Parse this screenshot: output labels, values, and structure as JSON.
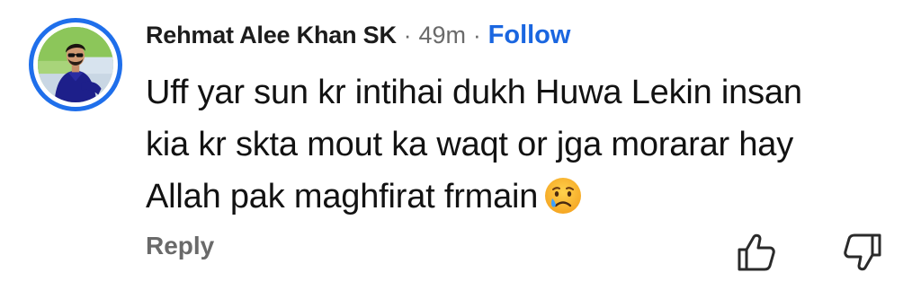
{
  "comment": {
    "author": "Rehmat Alee Khan SK",
    "separator": "·",
    "time": "49m",
    "follow_label": "Follow",
    "lines": [
      "Uff yar sun kr intihai dukh Huwa Lekin insan",
      "kia kr skta mout ka waqt or jga morarar hay",
      "Allah pak maghfirat frmain"
    ],
    "emoji": "crying-face-icon"
  },
  "actions": {
    "reply_label": "Reply",
    "like_icon": "thumbs-up-icon",
    "dislike_icon": "thumbs-down-icon"
  },
  "colors": {
    "avatar_ring": "#1f6feb",
    "follow": "#1a66e0",
    "muted": "#6a6a6a"
  }
}
